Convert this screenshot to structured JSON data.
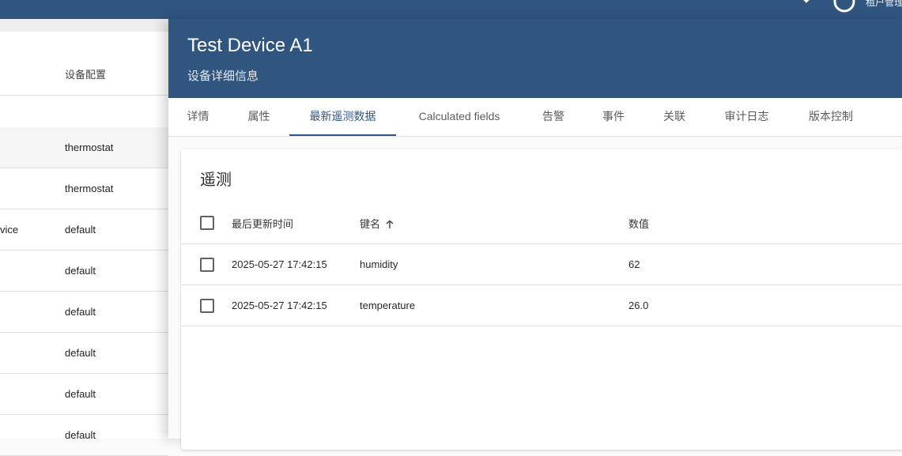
{
  "topbar": {
    "user_label": "租户管理",
    "colors": {
      "background": "#305680"
    }
  },
  "background_list": {
    "header": {
      "profile_label": "设备配置"
    },
    "rows": [
      {
        "name": "",
        "profile": "thermostat"
      },
      {
        "name": "",
        "profile": "thermostat"
      },
      {
        "name": "vice",
        "profile": "default"
      },
      {
        "name": "",
        "profile": "default"
      },
      {
        "name": "",
        "profile": "default"
      },
      {
        "name": "",
        "profile": "default"
      },
      {
        "name": "",
        "profile": "default"
      },
      {
        "name": "",
        "profile": "default"
      }
    ]
  },
  "drawer": {
    "title": "Test Device A1",
    "subtitle": "设备详细信息",
    "colors": {
      "header": "#305680",
      "accent": "#305680"
    },
    "tabs": [
      {
        "label": "详情"
      },
      {
        "label": "属性"
      },
      {
        "label": "最新遥测数据",
        "active": true
      },
      {
        "label": "Calculated fields"
      },
      {
        "label": "告警"
      },
      {
        "label": "事件"
      },
      {
        "label": "关联"
      },
      {
        "label": "审计日志"
      },
      {
        "label": "版本控制"
      }
    ]
  },
  "telemetry": {
    "title": "遥测",
    "columns": {
      "last_update": "最后更新时间",
      "key": "键名",
      "value": "数值"
    },
    "sort_icon": "arrow-up-icon",
    "rows": [
      {
        "last_update": "2025-05-27 17:42:15",
        "key": "humidity",
        "value": "62"
      },
      {
        "last_update": "2025-05-27 17:42:15",
        "key": "temperature",
        "value": "26.0"
      }
    ]
  }
}
